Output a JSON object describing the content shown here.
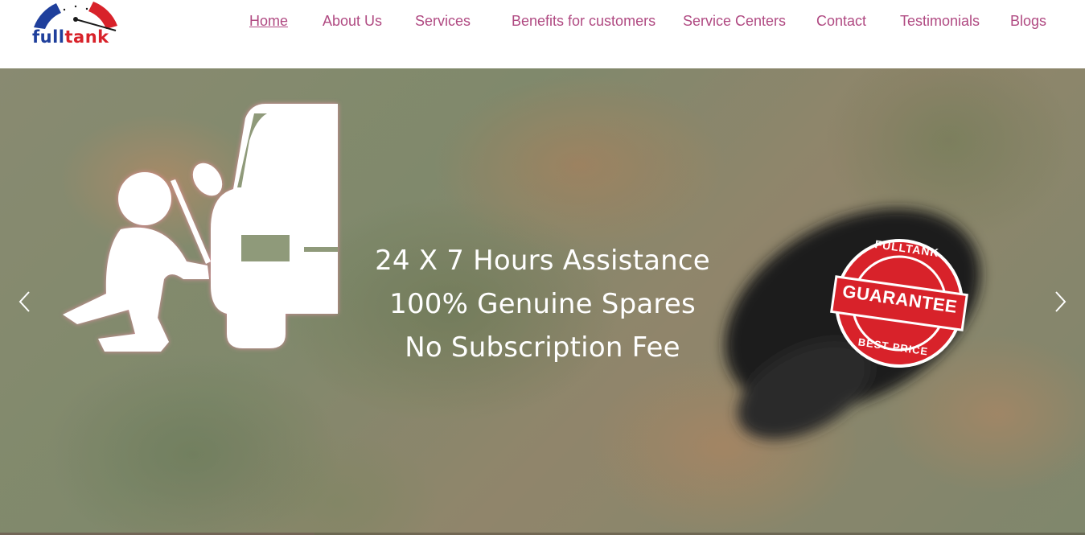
{
  "brand": {
    "name_part1": "full",
    "name_part2": "tank",
    "colors": {
      "blue": "#1f3f9c",
      "red": "#d8222a",
      "nav": "#b04a82"
    },
    "icon": "speedometer-icon"
  },
  "nav": {
    "items": [
      {
        "label": "Home",
        "active": true
      },
      {
        "label": "About Us",
        "active": false
      },
      {
        "label": "Services",
        "active": false
      },
      {
        "label": "Benefits for customers",
        "active": false
      },
      {
        "label": "Service Centers",
        "active": false
      },
      {
        "label": "Contact",
        "active": false
      },
      {
        "label": "Testimonials",
        "active": false
      },
      {
        "label": "Blogs",
        "active": false
      }
    ]
  },
  "hero": {
    "lines": [
      "24 X 7 Hours Assistance",
      "100% Genuine Spares",
      "No Subscription Fee"
    ],
    "illustration": "roadside-mechanic-icon",
    "badge": {
      "top_text": "FULLTANK",
      "center_text": "GUARANTEE",
      "bottom_text": "BEST PRICE",
      "color": "#d8222a"
    },
    "prev_icon": "chevron-left-icon",
    "next_icon": "chevron-right-icon",
    "slide_progress": 0.29
  }
}
